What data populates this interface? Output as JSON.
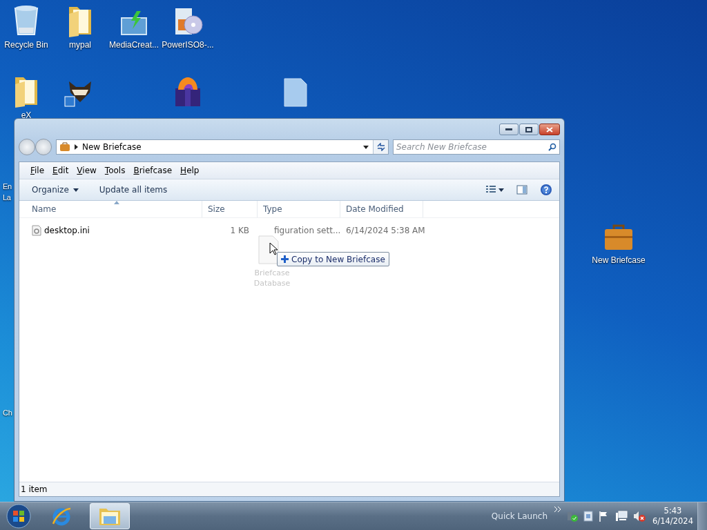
{
  "desktop": {
    "icons": [
      {
        "kind": "recycle",
        "label": "Recycle Bin"
      },
      {
        "kind": "folder",
        "label": "mypal"
      },
      {
        "kind": "media",
        "label": "MediaCreat..."
      },
      {
        "kind": "disc",
        "label": "PowerISO8-..."
      },
      {
        "kind": "folder",
        "label": "eX"
      },
      {
        "kind": "animal"
      },
      {
        "kind": "giftbox"
      },
      {
        "kind": "file"
      },
      {
        "kind": "briefcase",
        "label": "New Briefcase"
      }
    ],
    "edge_labels": [
      "En",
      "La",
      "Ch"
    ]
  },
  "window": {
    "address": "New Briefcase",
    "search": {
      "placeholder": "Search New Briefcase"
    },
    "menu": [
      "File",
      "Edit",
      "View",
      "Tools",
      "Briefcase",
      "Help"
    ],
    "commands": [
      {
        "label": "Organize",
        "kind": "dropdown"
      },
      {
        "label": "Update all items",
        "kind": "plain"
      }
    ],
    "columns": [
      {
        "label": "Name",
        "sorted": true
      },
      {
        "label": "Size",
        "sorted": false
      },
      {
        "label": "Type",
        "sorted": false
      },
      {
        "label": "Date Modified",
        "sorted": false
      }
    ],
    "rows": [
      {
        "name": "desktop.ini",
        "size": "1 KB",
        "type": "figuration sett...",
        "date": "6/14/2024 5:38 AM"
      }
    ],
    "drag": {
      "label": "Briefcase Database",
      "tooltip": "Copy to New Briefcase"
    },
    "status": "1 item"
  },
  "taskbar": {
    "tasks": [
      {
        "kind": "browser",
        "selected": false
      },
      {
        "kind": "explorer",
        "selected": true
      }
    ],
    "quick_launch": "Quick Launch",
    "time": "5:43",
    "date": "6/14/2024"
  }
}
